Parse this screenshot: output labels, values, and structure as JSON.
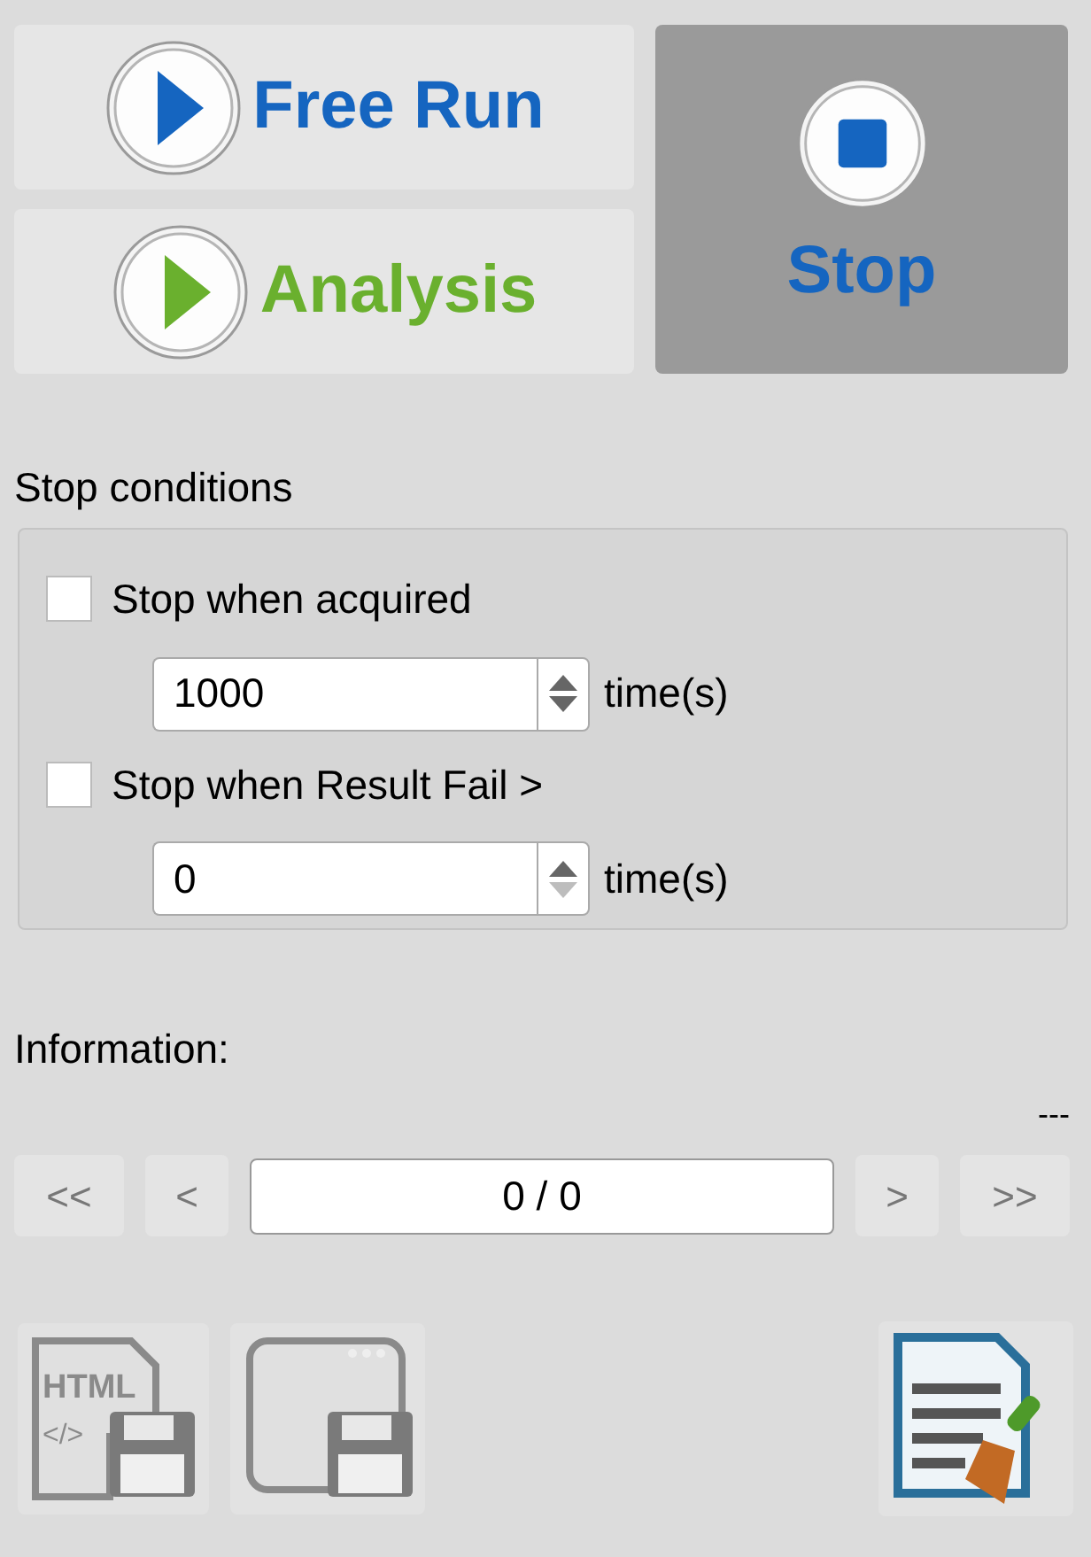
{
  "run_buttons": [
    {
      "kind": "play",
      "label": "Free Run",
      "color": "#1565c0",
      "selected": false
    },
    {
      "kind": "play",
      "label": "Analysis",
      "color": "#6ab02e",
      "selected": false
    }
  ],
  "stop_button": {
    "label": "Stop",
    "selected": true
  },
  "stop_conditions": {
    "title": "Stop conditions",
    "items": [
      {
        "label": "Stop when acquired",
        "checked": false,
        "value": "1000",
        "down_disabled": false,
        "unit": "time(s)"
      },
      {
        "label": "Stop when Result Fail >",
        "checked": false,
        "value": "0",
        "down_disabled": true,
        "unit": "time(s)"
      }
    ]
  },
  "information": {
    "title": "Information:",
    "status": "---"
  },
  "navigator": {
    "first": "<<",
    "prev": "<",
    "position": "0 / 0",
    "next": ">",
    "last": ">>"
  },
  "toolbar": {
    "html_label": "HTML",
    "html_code": "</>"
  }
}
